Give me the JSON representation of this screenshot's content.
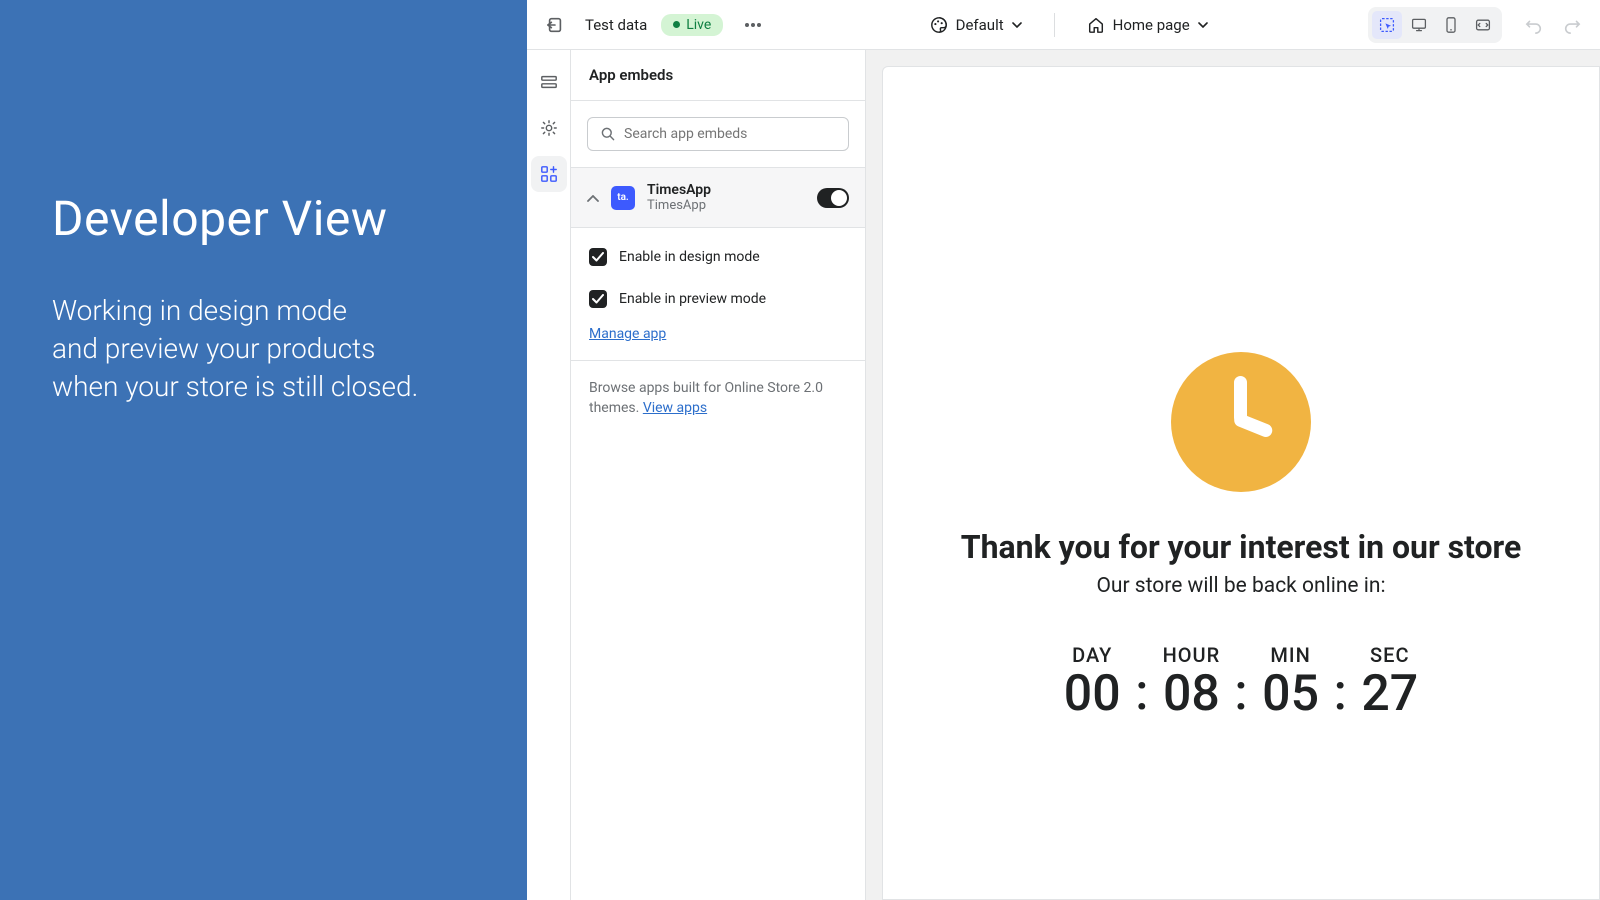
{
  "left": {
    "title": "Developer View",
    "desc_line1": "Working in design mode",
    "desc_line2": "and preview your products",
    "desc_line3": "when your store is still closed."
  },
  "topbar": {
    "title": "Test data",
    "live_label": "Live",
    "style_selector": "Default",
    "page_selector": "Home page"
  },
  "panel": {
    "header": "App embeds",
    "search_placeholder": "Search app embeds",
    "app": {
      "icon_text": "ta.",
      "name": "TimesApp",
      "subtitle": "TimesApp"
    },
    "checkbox1": "Enable in design mode",
    "checkbox2": "Enable in preview mode",
    "manage_link": "Manage app",
    "browse_prefix": "Browse apps built for Online Store 2.0 themes. ",
    "browse_link": "View apps"
  },
  "preview": {
    "title": "Thank you for your interest in our store",
    "subtitle": "Our store will be back online in:",
    "countdown": {
      "day_label": "DAY",
      "hour_label": "HOUR",
      "min_label": "MIN",
      "sec_label": "SEC",
      "day": "00",
      "hour": "08",
      "min": "05",
      "sec": "27"
    }
  }
}
